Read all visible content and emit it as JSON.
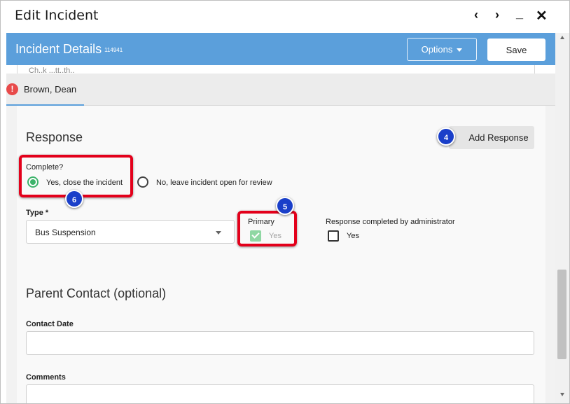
{
  "window": {
    "title": "Edit Incident",
    "prev_label": "‹",
    "next_label": "›",
    "minimize_label": "_",
    "close_label": "✕"
  },
  "header": {
    "title": "Incident Details",
    "incident_id": "114941",
    "options_label": "Options",
    "save_label": "Save"
  },
  "card_peek": {
    "text": "Ch..k ...tt..th.."
  },
  "tab": {
    "alert_glyph": "!",
    "label": "Brown, Dean"
  },
  "response": {
    "section_title": "Response",
    "add_response_label": "Add Response",
    "complete_label": "Complete?",
    "complete_options": [
      "Yes, close the incident",
      "No, leave incident open for review"
    ],
    "complete_selected": "Yes, close the incident",
    "type_label": "Type *",
    "type_value": "Bus Suspension",
    "primary_label": "Primary",
    "primary_option": "Yes",
    "admin_label": "Response completed by administrator",
    "admin_option": "Yes"
  },
  "parent_contact": {
    "section_title": "Parent Contact (optional)",
    "contact_date_label": "Contact Date",
    "contact_date_value": "",
    "comments_label": "Comments",
    "comments_value": ""
  },
  "callouts": {
    "add_response": "4",
    "primary": "5",
    "complete": "6"
  },
  "colors": {
    "header_blue": "#5b9fdb",
    "highlight_red": "#e3001b",
    "badge_blue": "#1a3fc9",
    "radio_green": "#3db36b",
    "alert_red": "#e84a4a"
  }
}
